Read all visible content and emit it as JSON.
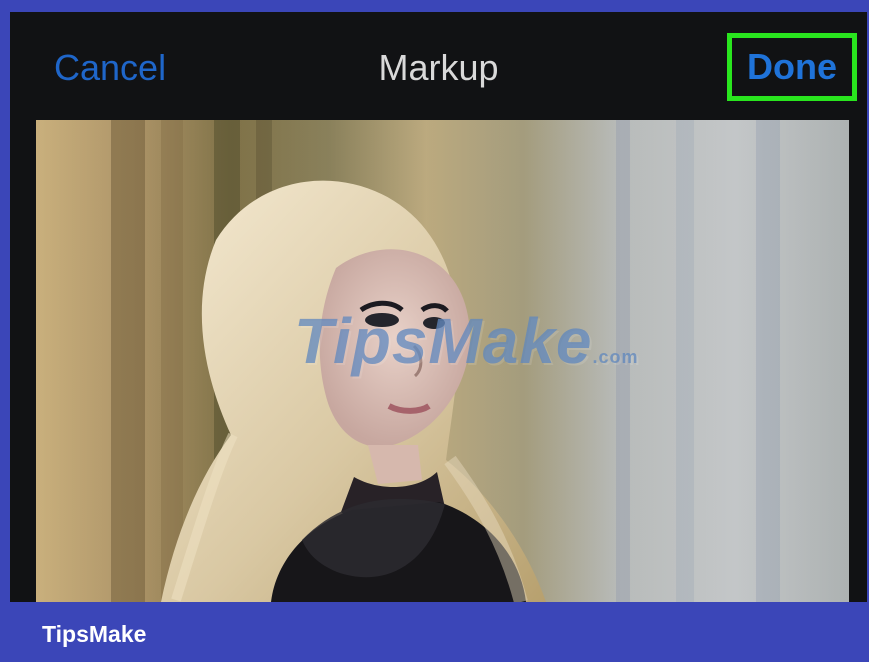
{
  "navbar": {
    "cancel_label": "Cancel",
    "title": "Markup",
    "done_label": "Done"
  },
  "watermark": {
    "brand": "TipsMake",
    "suffix": ".com"
  },
  "footer": {
    "brand": "TipsMake"
  },
  "colors": {
    "frame_background": "#3b46b8",
    "app_background": "#111214",
    "highlight_box": "#29e51e",
    "accent": "#1f66c9"
  },
  "icons": []
}
